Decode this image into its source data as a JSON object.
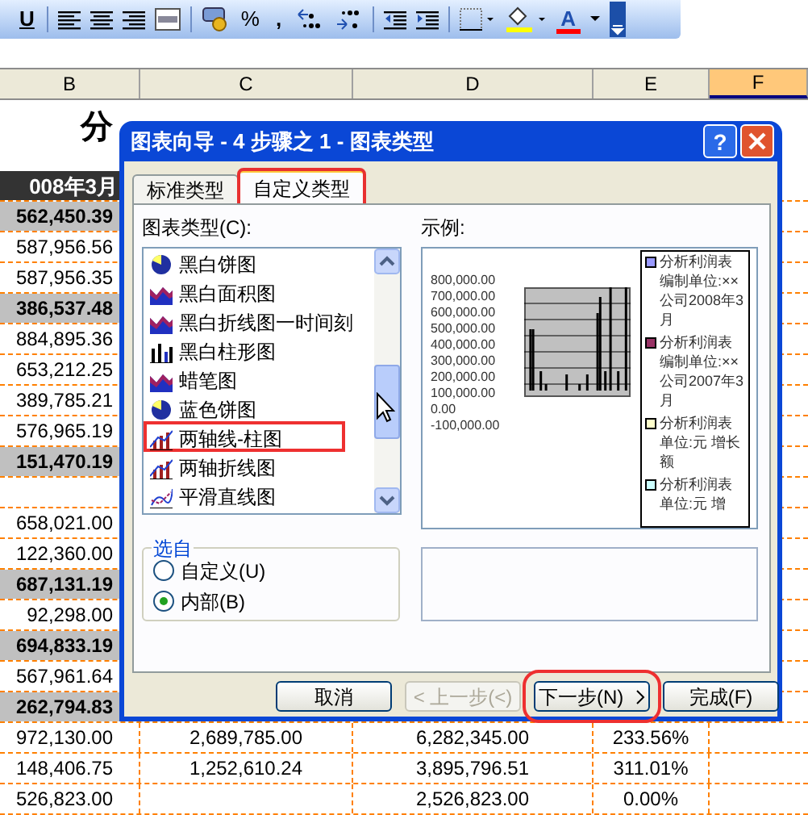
{
  "toolbar": {
    "glyph_buttons": [
      "U",
      "%",
      ",",
      "A"
    ]
  },
  "sheet": {
    "columns": [
      {
        "label": "B",
        "selected": false
      },
      {
        "label": "C",
        "selected": false
      },
      {
        "label": "D",
        "selected": false
      },
      {
        "label": "E",
        "selected": false
      },
      {
        "label": "F",
        "selected": true
      }
    ],
    "title": "分",
    "header": "008年3月",
    "rows": [
      {
        "kind": "total",
        "cells": [
          "562,450.39",
          "",
          "",
          ""
        ]
      },
      {
        "kind": "normal",
        "cells": [
          "587,956.56",
          "",
          "",
          ""
        ]
      },
      {
        "kind": "normal",
        "cells": [
          "587,956.35",
          "",
          "",
          ""
        ]
      },
      {
        "kind": "total",
        "cells": [
          "386,537.48",
          "",
          "",
          ""
        ]
      },
      {
        "kind": "normal",
        "cells": [
          "884,895.36",
          "",
          "",
          ""
        ]
      },
      {
        "kind": "normal",
        "cells": [
          "653,212.25",
          "",
          "",
          ""
        ]
      },
      {
        "kind": "normal",
        "cells": [
          "389,785.21",
          "",
          "",
          ""
        ]
      },
      {
        "kind": "normal",
        "cells": [
          "576,965.19",
          "",
          "",
          ""
        ]
      },
      {
        "kind": "total",
        "cells": [
          "151,470.19",
          "",
          "",
          ""
        ]
      },
      {
        "kind": "normal",
        "cells": [
          "",
          "",
          "",
          ""
        ]
      },
      {
        "kind": "normal",
        "cells": [
          "658,021.00",
          "",
          "",
          ""
        ]
      },
      {
        "kind": "normal",
        "cells": [
          "122,360.00",
          "",
          "",
          ""
        ]
      },
      {
        "kind": "total",
        "cells": [
          "687,131.19",
          "",
          "",
          ""
        ]
      },
      {
        "kind": "normal",
        "cells": [
          "92,298.00",
          "",
          "",
          ""
        ]
      },
      {
        "kind": "total",
        "cells": [
          "694,833.19",
          "",
          "",
          ""
        ]
      },
      {
        "kind": "normal",
        "cells": [
          "567,961.64",
          "",
          "",
          ""
        ]
      },
      {
        "kind": "total",
        "cells": [
          "262,794.83",
          "",
          "",
          ""
        ]
      },
      {
        "kind": "normal",
        "cells": [
          "972,130.00",
          "2,689,785.00",
          "6,282,345.00",
          "233.56%"
        ]
      },
      {
        "kind": "normal",
        "cells": [
          "148,406.75",
          "1,252,610.24",
          "3,895,796.51",
          "311.01%"
        ]
      },
      {
        "kind": "normal",
        "cells": [
          "526,823.00",
          "",
          "2,526,823.00",
          "0.00%"
        ]
      }
    ]
  },
  "dialog": {
    "title": "图表向导 - 4 步骤之 1 - 图表类型",
    "title_buttons": [
      "?"
    ],
    "tabs": [
      {
        "label": "标准类型",
        "selected": false
      },
      {
        "label": "自定义类型",
        "selected": true
      }
    ],
    "list_label": "图表类型(C):",
    "chart_types": [
      {
        "label": "黑白饼图",
        "selected": false
      },
      {
        "label": "黑白面积图",
        "selected": false
      },
      {
        "label": "黑白折线图一时间刻",
        "selected": false
      },
      {
        "label": "黑白柱形图",
        "selected": false
      },
      {
        "label": "蜡笔图",
        "selected": false
      },
      {
        "label": "蓝色饼图",
        "selected": false
      },
      {
        "label": "两轴线-柱图",
        "selected": false
      },
      {
        "label": "两轴折线图",
        "selected": false
      },
      {
        "label": "平滑直线图",
        "selected": false
      }
    ],
    "sample_label": "示例:",
    "sample": {
      "y_labels": [
        "800,000.00",
        "700,000.00",
        "600,000.00",
        "500,000.00",
        "400,000.00",
        "300,000.00",
        "200,000.00",
        "100,000.00",
        "0.00",
        "-100,000.00"
      ],
      "legend": [
        {
          "label": "分析利润表编制单位:××公司2008年3月",
          "color": "#9999ff"
        },
        {
          "label": "分析利润表编制单位:××公司2007年3月",
          "color": "#993366"
        },
        {
          "label": "分析利润表单位:元 增长额",
          "color": "#ffffcc"
        },
        {
          "label": "分析利润表单位:元 增",
          "color": "#ccffff"
        }
      ]
    },
    "source_group": {
      "label": "选自",
      "options": [
        {
          "label": "自定义(U)",
          "selected": false
        },
        {
          "label": "内部(B)",
          "selected": true
        }
      ]
    },
    "buttons": [
      {
        "label": "取消",
        "disabled": false,
        "kind": "plain"
      },
      {
        "label": "< 上一步(<)",
        "disabled": true,
        "kind": "plain"
      },
      {
        "label": "下一步(N)",
        "disabled": false,
        "kind": "next"
      },
      {
        "label": "完成(F)",
        "disabled": false,
        "kind": "plain"
      }
    ]
  }
}
